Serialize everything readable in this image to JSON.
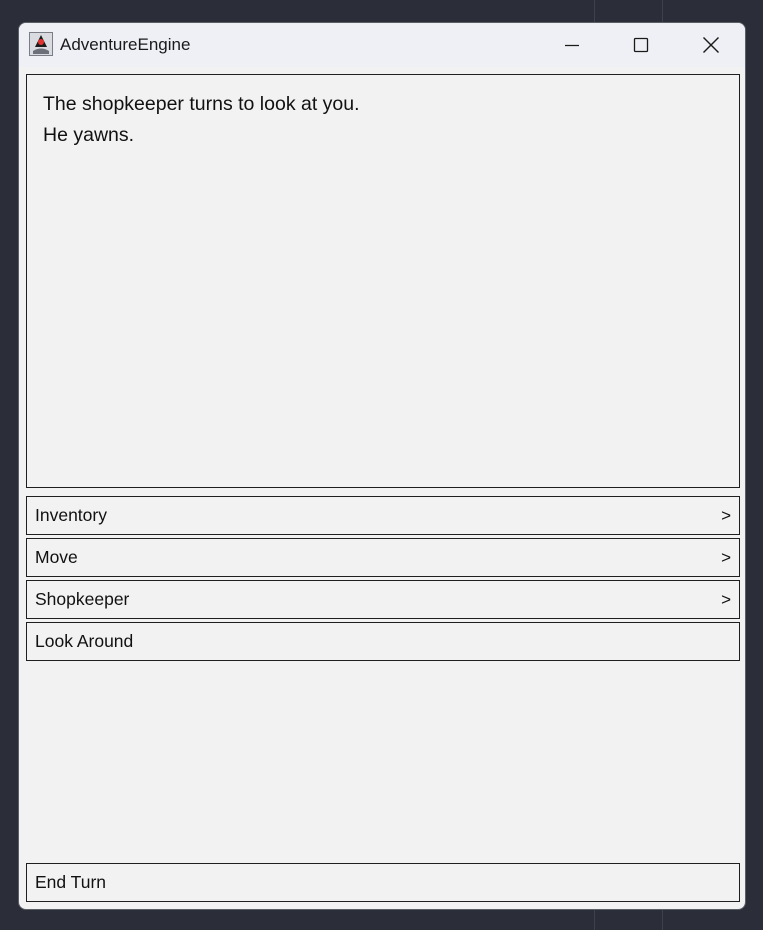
{
  "window": {
    "title": "AdventureEngine",
    "app_icon": "java-duke-icon",
    "controls": [
      "minimize-icon",
      "maximize-icon",
      "close-icon"
    ]
  },
  "log": {
    "lines": [
      "The shopkeeper turns to look at you.",
      "He yawns."
    ]
  },
  "actions": [
    {
      "label": "Inventory",
      "indicator": ">"
    },
    {
      "label": "Move",
      "indicator": ">"
    },
    {
      "label": "Shopkeeper",
      "indicator": ">"
    },
    {
      "label": "Look Around",
      "indicator": ""
    }
  ],
  "end_turn": {
    "label": "End Turn"
  },
  "colors": {
    "desktop": "#2b2e38",
    "window_bg": "#f2f2f2",
    "titlebar_bg": "#eef0f5",
    "border": "#1f1f1f"
  }
}
